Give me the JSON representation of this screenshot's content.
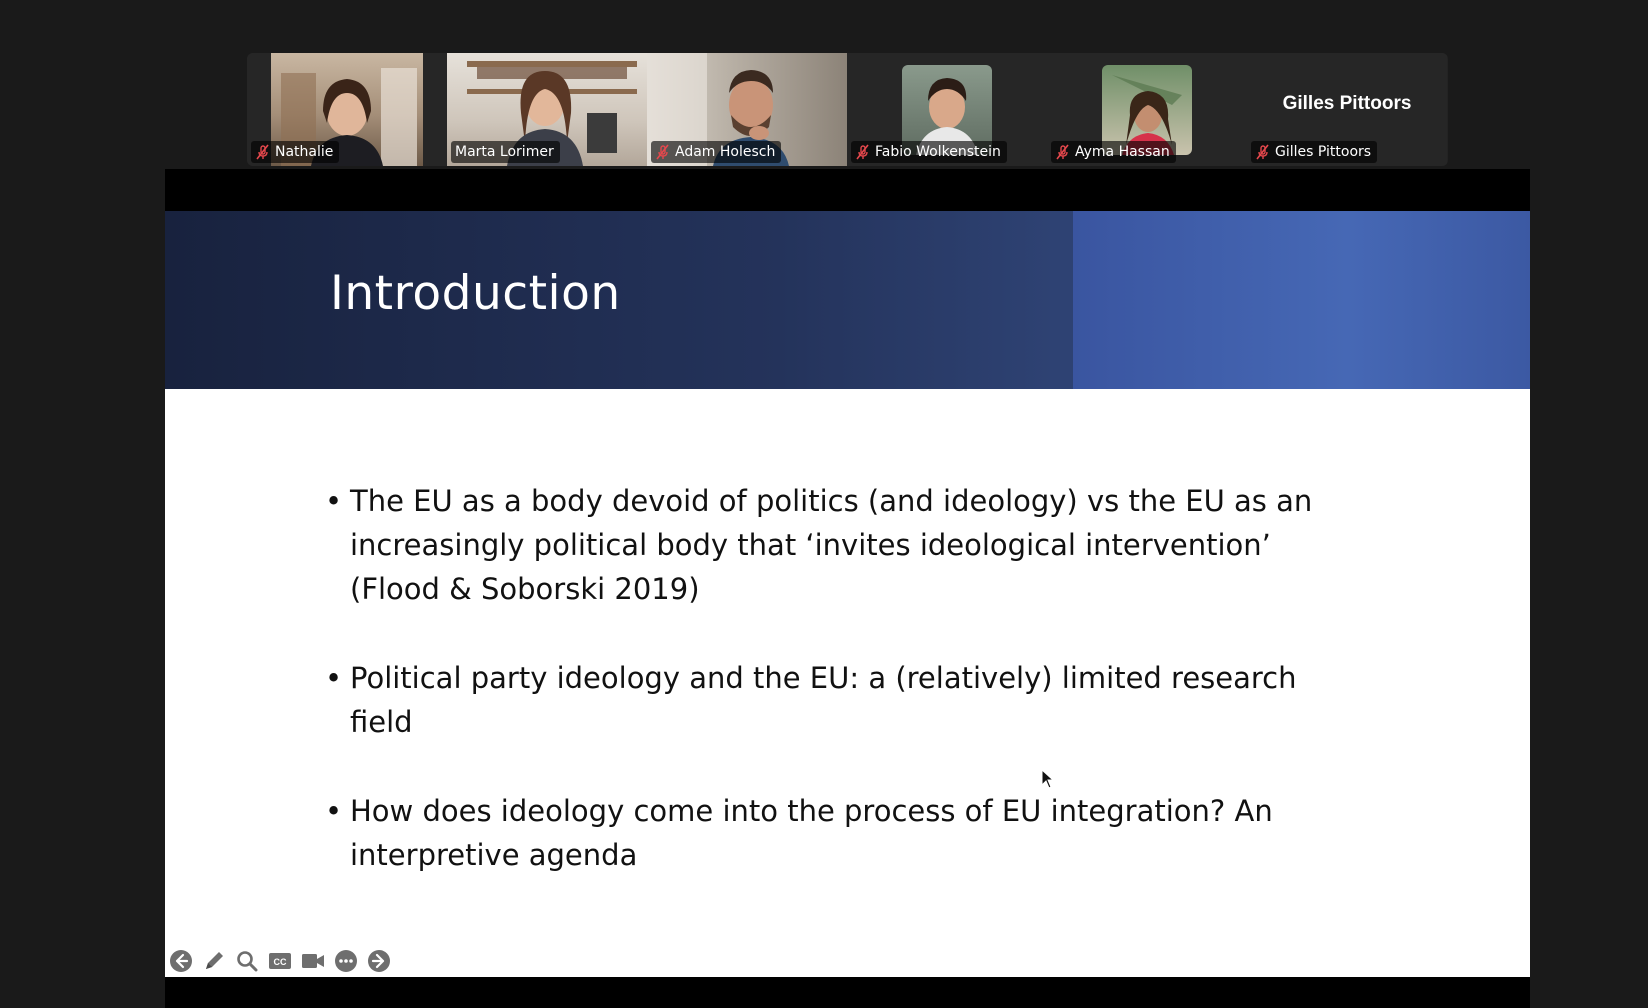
{
  "participants": [
    {
      "name": "Nathalie",
      "muted": true,
      "active": false
    },
    {
      "name": "Marta Lorimer",
      "muted": false,
      "active": true
    },
    {
      "name": "Adam Holesch",
      "muted": true,
      "active": false
    },
    {
      "name": "Fabio Wolkenstein",
      "muted": true,
      "active": false
    },
    {
      "name": "Ayma Hassan",
      "muted": true,
      "active": false
    },
    {
      "name": "Gilles Pittoors",
      "muted": true,
      "active": false,
      "avatar_text": "Gilles Pittoors"
    }
  ],
  "slide": {
    "title": "Introduction",
    "bullets": [
      "The EU as a body devoid of politics (and ideology) vs the EU as an increasingly political body that ‘invites ideological intervention’ (Flood & Soborski 2019)",
      "Political party ideology and the EU: a (relatively) limited research field",
      "How does ideology come into the process of EU integration? An interpretive agenda"
    ]
  },
  "toolbar": {
    "icons": [
      "previous-slide-icon",
      "pen-icon",
      "zoom-icon",
      "closed-caption-icon",
      "video-icon",
      "more-options-icon",
      "next-slide-icon"
    ],
    "cc_label": "CC"
  },
  "colors": {
    "active_speaker": "#2dd47a",
    "muted_mic": "#e5484d",
    "slide_header": "#24335b",
    "slide_accent": "#4668b5"
  }
}
